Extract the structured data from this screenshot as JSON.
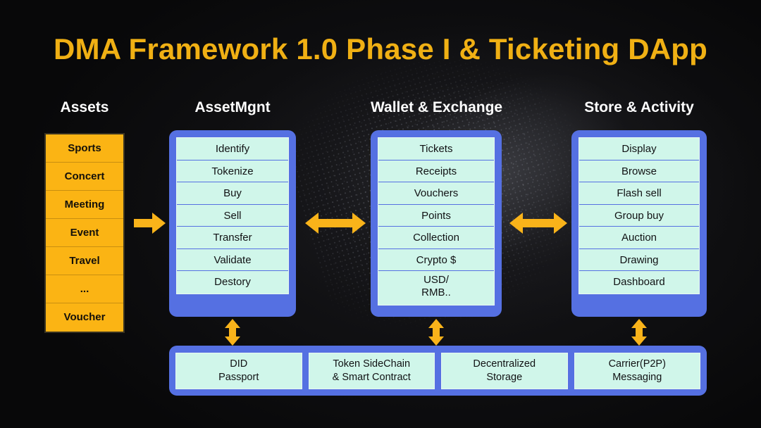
{
  "title": "DMA Framework 1.0 Phase I & Ticketing DApp",
  "colors": {
    "title_gold": "#f0b014",
    "arrow_orange": "#f9b31a",
    "asset_orange": "#fbb414",
    "panel_blue": "#5570e2",
    "cell_mint": "#d0f6ea",
    "background": "#070707",
    "header_text": "#ffffff"
  },
  "columns": [
    {
      "id": "assets",
      "header": "Assets",
      "style": "orange",
      "items": [
        "Sports",
        "Concert",
        "Meeting",
        "Event",
        "Travel",
        "...",
        "Voucher"
      ]
    },
    {
      "id": "assetmgnt",
      "header": "AssetMgnt",
      "style": "blue",
      "items": [
        "Identify",
        "Tokenize",
        "Buy",
        "Sell",
        "Transfer",
        "Validate",
        "Destory"
      ]
    },
    {
      "id": "wallet",
      "header": "Wallet & Exchange",
      "style": "blue",
      "items": [
        "Tickets",
        "Receipts",
        "Vouchers",
        "Points",
        "Collection",
        "Crypto $",
        "USD/\nRMB.."
      ]
    },
    {
      "id": "store",
      "header": "Store & Activity",
      "style": "blue",
      "items": [
        "Display",
        "Browse",
        "Flash sell",
        "Group buy",
        "Auction",
        "Drawing",
        "Dashboard"
      ]
    }
  ],
  "infrastructure": {
    "items": [
      {
        "line1": "DID",
        "line2": "Passport"
      },
      {
        "line1": "Token SideChain",
        "line2": "& Smart Contract"
      },
      {
        "line1": "Decentralized",
        "line2": "Storage"
      },
      {
        "line1": "Carrier(P2P)",
        "line2": "Messaging"
      }
    ]
  },
  "arrows": [
    {
      "id": "assets-to-assetmgnt",
      "direction": "right",
      "icon": "arrow-right-icon"
    },
    {
      "id": "assetmgnt-to-wallet",
      "direction": "left-right",
      "icon": "arrow-left-right-icon"
    },
    {
      "id": "wallet-to-store",
      "direction": "left-right",
      "icon": "arrow-left-right-icon"
    },
    {
      "id": "assetmgnt-to-infra",
      "direction": "up-down",
      "icon": "arrow-up-down-icon"
    },
    {
      "id": "wallet-to-infra",
      "direction": "up-down",
      "icon": "arrow-up-down-icon"
    },
    {
      "id": "store-to-infra",
      "direction": "up-down",
      "icon": "arrow-up-down-icon"
    }
  ]
}
